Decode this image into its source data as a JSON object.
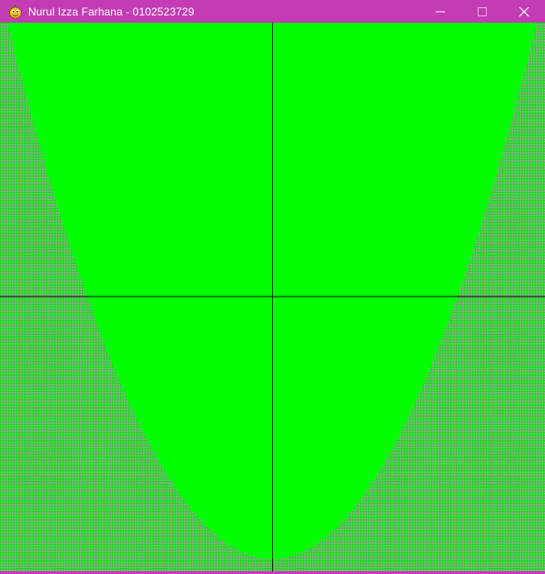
{
  "window": {
    "title": "Nurul Izza Farhana - 0102523729",
    "app_icon": "pygame-snake-icon",
    "controls": [
      "minimize-icon",
      "maximize-icon",
      "close-icon"
    ],
    "frame_color": "#c43cb4"
  },
  "canvas": {
    "background_color": "#a8a0a8",
    "grid_color": "#00e600",
    "fill_color": "#00ff00",
    "axis_color": "#000000",
    "shape": "parabola",
    "axes_visible": true,
    "grid_visible": true
  }
}
